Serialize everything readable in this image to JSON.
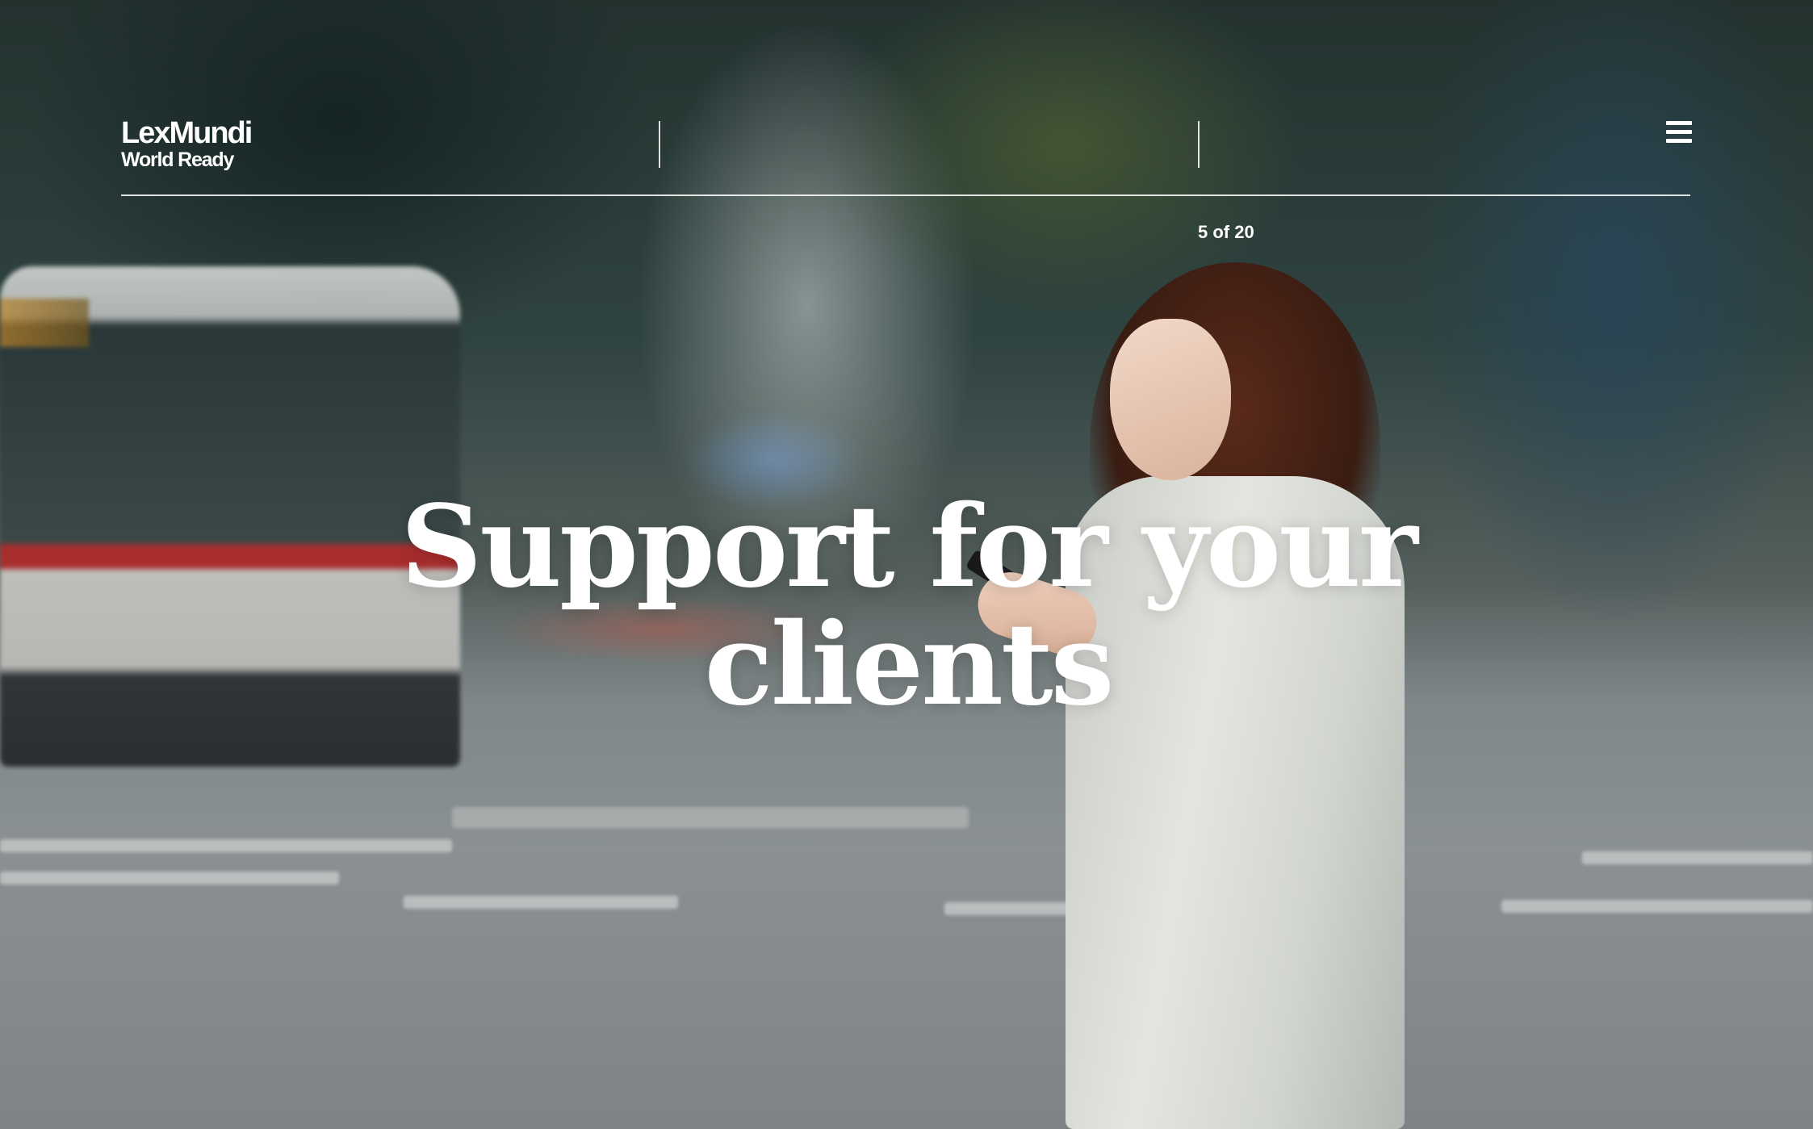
{
  "header": {
    "logo": {
      "line1": "LexMundi",
      "line2": "World Ready"
    },
    "menu_icon": "hamburger-menu-icon"
  },
  "slide": {
    "counter": "5 of 20",
    "headline": "Support for your clients"
  },
  "colors": {
    "text": "#ffffff",
    "rule": "#ffffff"
  }
}
